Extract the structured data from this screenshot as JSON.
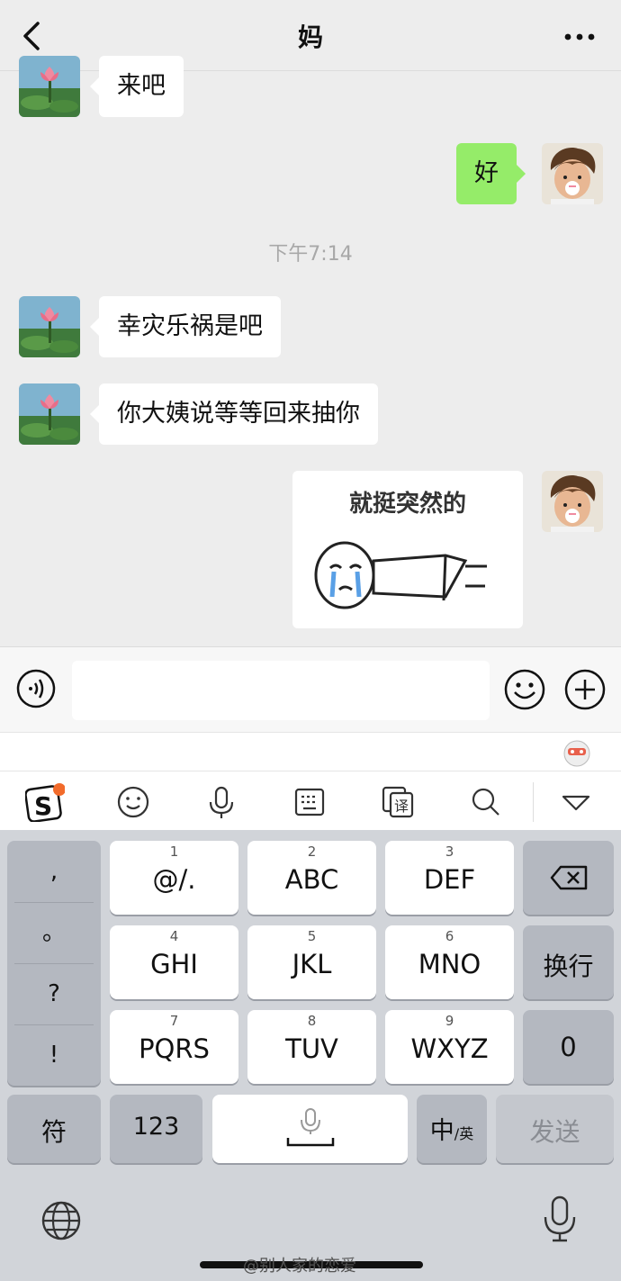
{
  "header": {
    "title": "妈"
  },
  "messages": [
    {
      "side": "left",
      "text": "来吧"
    },
    {
      "side": "right",
      "text": "好"
    },
    {
      "side": "left",
      "text": "幸灾乐祸是吧"
    },
    {
      "side": "left",
      "text": "你大姨说等等回来抽你"
    }
  ],
  "timestamp": "下午7:14",
  "sticker": {
    "text": "就挺突然的"
  },
  "keyboard": {
    "punct": [
      ",",
      "。",
      "?",
      "!"
    ],
    "keys": [
      {
        "num": "1",
        "label": "@/."
      },
      {
        "num": "2",
        "label": "ABC"
      },
      {
        "num": "3",
        "label": "DEF"
      },
      {
        "num": "4",
        "label": "GHI"
      },
      {
        "num": "5",
        "label": "JKL"
      },
      {
        "num": "6",
        "label": "MNO"
      },
      {
        "num": "7",
        "label": "PQRS"
      },
      {
        "num": "8",
        "label": "TUV"
      },
      {
        "num": "9",
        "label": "WXYZ"
      }
    ],
    "newline_label": "换行",
    "zero_label": "0",
    "symbol_label": "符",
    "num_label": "123",
    "lang_label": "中",
    "lang_sub": "/英",
    "send_label": "发送"
  },
  "watermark": "@别人家的恋爱",
  "colors": {
    "accent_bubble": "#95ec69",
    "background": "#ededed"
  }
}
